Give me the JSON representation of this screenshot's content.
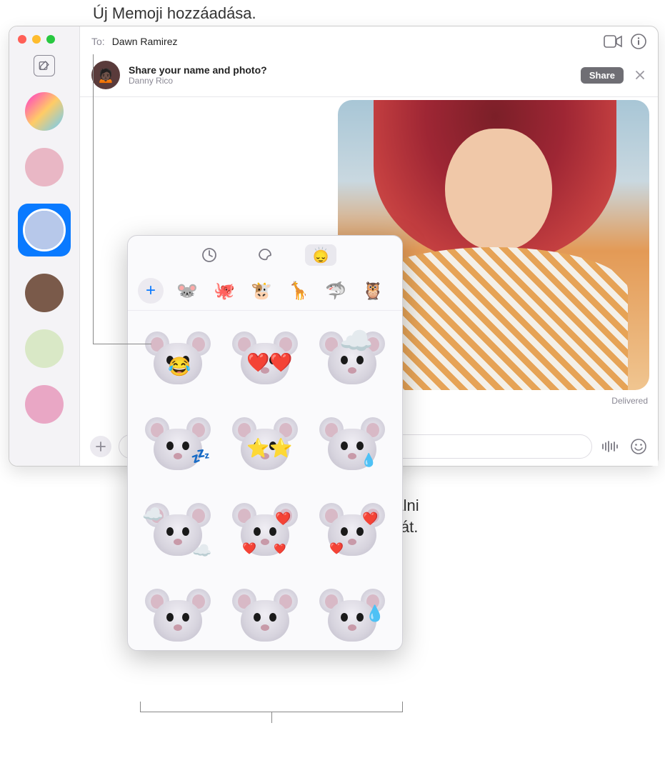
{
  "callouts": {
    "top": "Új Memoji hozzáadása.",
    "bottom_l1": "Válassza ki a használni",
    "bottom_l2": "kívánt Memoji-matricát."
  },
  "topbar": {
    "to_label": "To:",
    "to_name": "Dawn Ramirez"
  },
  "banner": {
    "question": "Share your name and photo?",
    "subtitle": "Danny Rico",
    "share_btn": "Share"
  },
  "status": {
    "delivered": "Delivered"
  },
  "sidebar": {
    "compose_icon": "compose-icon",
    "conversations": [
      {
        "name": "group-1"
      },
      {
        "name": "contact-2"
      },
      {
        "name": "contact-3-selected"
      },
      {
        "name": "contact-4"
      },
      {
        "name": "contact-5"
      },
      {
        "name": "contact-6"
      }
    ]
  },
  "popover": {
    "tabs": [
      {
        "icon": "clock-icon",
        "active": false
      },
      {
        "icon": "sticker-pack-icon",
        "active": false
      },
      {
        "icon": "memoji-icon",
        "active": true
      }
    ],
    "avatar_row": {
      "add": "+",
      "items": [
        {
          "label": "mouse",
          "emoji": "🐭"
        },
        {
          "label": "octopus",
          "emoji": "🐙"
        },
        {
          "label": "cow",
          "emoji": "🐮"
        },
        {
          "label": "giraffe",
          "emoji": "🦒"
        },
        {
          "label": "shark",
          "emoji": "🦈"
        },
        {
          "label": "owl",
          "emoji": "🦉"
        }
      ]
    },
    "stickers": [
      {
        "name": "mouse-joy-tears",
        "overlays": [
          {
            "e": "😂",
            "pos": "center"
          }
        ]
      },
      {
        "name": "mouse-heart-eyes",
        "overlays": [
          {
            "e": "❤️",
            "pos": "eye-l"
          },
          {
            "e": "❤️",
            "pos": "eye-r"
          }
        ]
      },
      {
        "name": "mouse-mind-blown",
        "overlays": [
          {
            "e": "☁️",
            "pos": "top"
          }
        ]
      },
      {
        "name": "mouse-sleeping",
        "overlays": [
          {
            "e": "💤",
            "pos": "right"
          }
        ]
      },
      {
        "name": "mouse-starstruck",
        "overlays": [
          {
            "e": "⭐",
            "pos": "eye-l"
          },
          {
            "e": "⭐",
            "pos": "eye-r"
          }
        ]
      },
      {
        "name": "mouse-sad-tear",
        "overlays": [
          {
            "e": "💧",
            "pos": "eye-r-low"
          }
        ]
      },
      {
        "name": "mouse-in-clouds",
        "overlays": [
          {
            "e": "☁️",
            "pos": "tl"
          },
          {
            "e": "☁️",
            "pos": "br"
          }
        ]
      },
      {
        "name": "mouse-hearts",
        "overlays": [
          {
            "e": "❤️",
            "pos": "tr"
          },
          {
            "e": "❤️",
            "pos": "bl"
          },
          {
            "e": "❤️",
            "pos": "br2"
          }
        ]
      },
      {
        "name": "mouse-hearts-2",
        "overlays": [
          {
            "e": "❤️",
            "pos": "tr"
          },
          {
            "e": "❤️",
            "pos": "bl"
          }
        ]
      },
      {
        "name": "mouse-neutral",
        "overlays": []
      },
      {
        "name": "mouse-angry",
        "overlays": []
      },
      {
        "name": "mouse-sweat",
        "overlays": [
          {
            "e": "💧",
            "pos": "tr-low"
          }
        ]
      }
    ]
  },
  "colors": {
    "accent": "#0a7aff"
  }
}
